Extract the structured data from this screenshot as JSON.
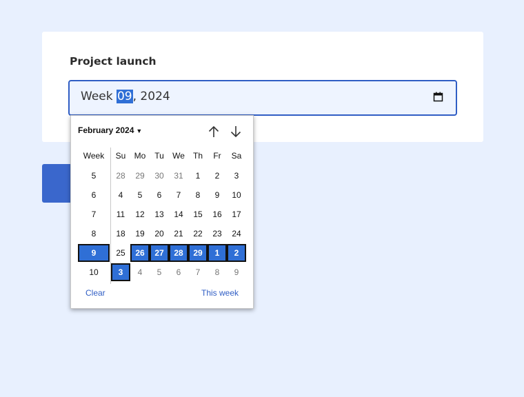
{
  "form": {
    "label": "Project launch",
    "week_prefix": "Week ",
    "week_number": "09",
    "week_suffix": ", 2024"
  },
  "picker": {
    "month_label": "February 2024",
    "week_header": "Week",
    "days": [
      "Su",
      "Mo",
      "Tu",
      "We",
      "Th",
      "Fr",
      "Sa"
    ],
    "rows": [
      {
        "week": "5",
        "dates": [
          "28",
          "29",
          "30",
          "31",
          "1",
          "2",
          "3"
        ],
        "dim": [
          1,
          1,
          1,
          1,
          0,
          0,
          0
        ]
      },
      {
        "week": "6",
        "dates": [
          "4",
          "5",
          "6",
          "7",
          "8",
          "9",
          "10"
        ],
        "dim": [
          0,
          0,
          0,
          0,
          0,
          0,
          0
        ]
      },
      {
        "week": "7",
        "dates": [
          "11",
          "12",
          "13",
          "14",
          "15",
          "16",
          "17"
        ],
        "dim": [
          0,
          0,
          0,
          0,
          0,
          0,
          0
        ]
      },
      {
        "week": "8",
        "dates": [
          "18",
          "19",
          "20",
          "21",
          "22",
          "23",
          "24"
        ],
        "dim": [
          0,
          0,
          0,
          0,
          0,
          0,
          0
        ]
      },
      {
        "week": "9",
        "dates": [
          "25",
          "26",
          "27",
          "28",
          "29",
          "1",
          "2"
        ],
        "dim": [
          0,
          0,
          0,
          0,
          0,
          0,
          0
        ],
        "selected_week": true,
        "sel": [
          0,
          1,
          1,
          1,
          1,
          1,
          1
        ]
      },
      {
        "week": "10",
        "dates": [
          "3",
          "4",
          "5",
          "6",
          "7",
          "8",
          "9"
        ],
        "dim": [
          0,
          1,
          1,
          1,
          1,
          1,
          1
        ],
        "sel": [
          1,
          0,
          0,
          0,
          0,
          0,
          0
        ]
      }
    ],
    "clear_label": "Clear",
    "this_week_label": "This week"
  },
  "icons": {
    "calendar": "calendar-icon",
    "prev": "arrow-up-icon",
    "next": "arrow-down-icon",
    "caret": "caret-down-icon"
  },
  "colors": {
    "accent": "#2f6fd6",
    "input_border": "#2f5dc4",
    "page_bg": "#e8f0fe"
  }
}
